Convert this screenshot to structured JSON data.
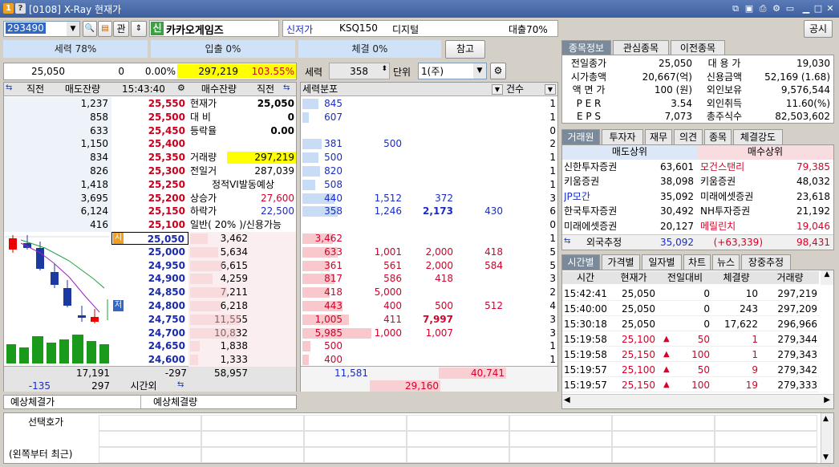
{
  "window": {
    "title": "[0108] X-Ray 현재가",
    "close_label": "공시"
  },
  "top": {
    "code": "293490",
    "gwan": "관",
    "name": "카카오게임즈",
    "shin": "신",
    "info1": "신저가",
    "info2": "KSQ150",
    "info3": "디지털",
    "info4": "대출70%"
  },
  "pills": {
    "power": "세력 78%",
    "inflow": "입출 0%",
    "exec": "체결 0%",
    "ref": "참고"
  },
  "price_row": {
    "price": "25,050",
    "change": "0",
    "rate": "0.00%",
    "volume": "297,219",
    "vol_rate": "103.55%",
    "power_label": "세력",
    "power_val": "358",
    "unit_label": "단위",
    "unit_val": "1(주)"
  },
  "ob_header": {
    "c1": "직전",
    "c2": "매도잔량",
    "time": "15:43:40",
    "c4": "매수잔량",
    "c5": "직전"
  },
  "asks": [
    {
      "qty": "1,237",
      "price": "25,550"
    },
    {
      "qty": "858",
      "price": "25,500"
    },
    {
      "qty": "633",
      "price": "25,450"
    },
    {
      "qty": "1,150",
      "price": "25,400"
    },
    {
      "qty": "834",
      "price": "25,350"
    },
    {
      "qty": "826",
      "price": "25,300"
    },
    {
      "qty": "1,418",
      "price": "25,250"
    },
    {
      "qty": "3,695",
      "price": "25,200"
    },
    {
      "qty": "6,124",
      "price": "25,150"
    },
    {
      "qty": "416",
      "price": "25,100"
    }
  ],
  "bids": [
    {
      "price": "25,050",
      "qty": "3,462",
      "tag": "시"
    },
    {
      "price": "25,000",
      "qty": "5,634",
      "tag": ""
    },
    {
      "price": "24,950",
      "qty": "6,615",
      "tag": ""
    },
    {
      "price": "24,900",
      "qty": "4,259",
      "tag": ""
    },
    {
      "price": "24,850",
      "qty": "7,211",
      "tag": ""
    },
    {
      "price": "24,800",
      "qty": "6,218",
      "tag": "저"
    },
    {
      "price": "24,750",
      "qty": "11,555",
      "tag": ""
    },
    {
      "price": "24,700",
      "qty": "10,832",
      "tag": ""
    },
    {
      "price": "24,650",
      "qty": "1,838",
      "tag": ""
    },
    {
      "price": "24,600",
      "qty": "1,333",
      "tag": ""
    }
  ],
  "mid_info": [
    {
      "label": "현재가",
      "value": "25,050"
    },
    {
      "label": "대 비",
      "value": "0"
    },
    {
      "label": "등락율",
      "value": "0.00"
    },
    {
      "label": "",
      "value": ""
    },
    {
      "label": "거래량",
      "value": "297,219"
    },
    {
      "label": "전일거",
      "value": "287,039"
    },
    {
      "label": "정적VI발동예상",
      "value": ""
    },
    {
      "label": "상승가",
      "value": "27,600"
    },
    {
      "label": "하락가",
      "value": "22,500"
    },
    {
      "label": "일반( 20% )/신용가능",
      "value": ""
    }
  ],
  "ob_footer": {
    "ask_total_prev": "-135",
    "ask_total": "17,191",
    "ask_total2": "297",
    "diff": "-297",
    "bid_total": "58,957",
    "aftertime": "시간외"
  },
  "expect": {
    "l1": "예상체결가",
    "l2": "예상체결량"
  },
  "dist": {
    "h1": "세력분포",
    "h2": "건수",
    "ask_rows": [
      [
        "845",
        "",
        "",
        "",
        "1"
      ],
      [
        "607",
        "",
        "",
        "",
        "1"
      ],
      [
        "",
        "",
        "",
        "",
        "0"
      ],
      [
        "381",
        "500",
        "",
        "",
        "2"
      ],
      [
        "500",
        "",
        "",
        "",
        "1"
      ],
      [
        "820",
        "",
        "",
        "",
        "1"
      ],
      [
        "508",
        "",
        "",
        "",
        "1"
      ],
      [
        "440",
        "1,512",
        "372",
        "",
        "3"
      ],
      [
        "358",
        "1,246",
        "2,173",
        "430",
        "6"
      ],
      [
        "",
        "",
        "",
        "",
        "0"
      ]
    ],
    "bid_rows": [
      [
        "3,462",
        "",
        "",
        "",
        "1"
      ],
      [
        "633",
        "1,001",
        "2,000",
        "418",
        "5"
      ],
      [
        "361",
        "561",
        "2,000",
        "584",
        "5"
      ],
      [
        "817",
        "586",
        "418",
        "",
        "3"
      ],
      [
        "418",
        "5,000",
        "",
        "",
        "2"
      ],
      [
        "443",
        "400",
        "500",
        "512",
        "4"
      ],
      [
        "1,005",
        "411",
        "7,997",
        "",
        "3"
      ],
      [
        "5,985",
        "1,000",
        "1,007",
        "",
        "3"
      ],
      [
        "500",
        "",
        "",
        "",
        "1"
      ],
      [
        "400",
        "",
        "",
        "",
        "1"
      ]
    ],
    "foot1": "11,581",
    "foot2": "40,741",
    "foot3": "29,160"
  },
  "stock_tabs": [
    "종목정보",
    "관심종목",
    "이전종목"
  ],
  "stock_info": [
    {
      "l": "전일종가",
      "v": "25,050",
      "l2": "대 용 가",
      "v2": "19,030"
    },
    {
      "l": "시가총액",
      "v": "20,667(억)",
      "l2": "신용금액",
      "v2": "52,169  (1.68)"
    },
    {
      "l": "액 면 가",
      "v": "100 (원)",
      "l2": "외인보유",
      "v2": "9,576,544"
    },
    {
      "l": "P E R",
      "v": "3.54",
      "l2": "외인취득",
      "v2": "11.60(%)"
    },
    {
      "l": "E P S",
      "v": "7,073",
      "l2": "총주식수",
      "v2": "82,503,602"
    }
  ],
  "broker_tabs": [
    "거래원",
    "투자자",
    "재무",
    "의견",
    "종목",
    "체결강도"
  ],
  "broker": {
    "sell_h": "매도상위",
    "buy_h": "매수상위",
    "rows": [
      [
        "신한투자증권",
        "63,601",
        "모건스탠리",
        "79,385"
      ],
      [
        "키움증권",
        "38,098",
        "키움증권",
        "48,032"
      ],
      [
        "JP모간",
        "35,092",
        "미래에셋증권",
        "23,618"
      ],
      [
        "한국투자증권",
        "30,492",
        "NH투자증권",
        "21,192"
      ],
      [
        "미래에셋증권",
        "20,127",
        "메릴린치",
        "19,046"
      ]
    ],
    "foreign_label": "외국추정",
    "foreign_sell": "35,092",
    "foreign_diff": "(+63,339)",
    "foreign_buy": "98,431"
  },
  "time_tabs": [
    "시간별",
    "가격별",
    "일자별",
    "차트",
    "뉴스",
    "장중추정"
  ],
  "ticks": {
    "h": [
      "시간",
      "현재가",
      "전일대비",
      "체결량",
      "거래량"
    ],
    "rows": [
      [
        "15:42:41",
        "25,050",
        "",
        "0",
        "10",
        "297,219"
      ],
      [
        "15:40:00",
        "25,050",
        "",
        "0",
        "243",
        "297,209"
      ],
      [
        "15:30:18",
        "25,050",
        "",
        "0",
        "17,622",
        "296,966"
      ],
      [
        "15:19:58",
        "25,100",
        "▲",
        "50",
        "1",
        "279,344"
      ],
      [
        "15:19:58",
        "25,150",
        "▲",
        "100",
        "1",
        "279,343"
      ],
      [
        "15:19:57",
        "25,100",
        "▲",
        "50",
        "9",
        "279,342"
      ],
      [
        "15:19:57",
        "25,150",
        "▲",
        "100",
        "19",
        "279,333"
      ]
    ]
  },
  "bottom": {
    "l1": "선택호가",
    "l2": "(왼쪽부터 최근)"
  },
  "colors": {
    "accent": "#3168c6",
    "ask_bg": "#eef3fa",
    "bid_bg": "#fbeef0",
    "up": "#d8002a",
    "down": "#1a2cc8",
    "volume_hl": "#ffff00"
  }
}
